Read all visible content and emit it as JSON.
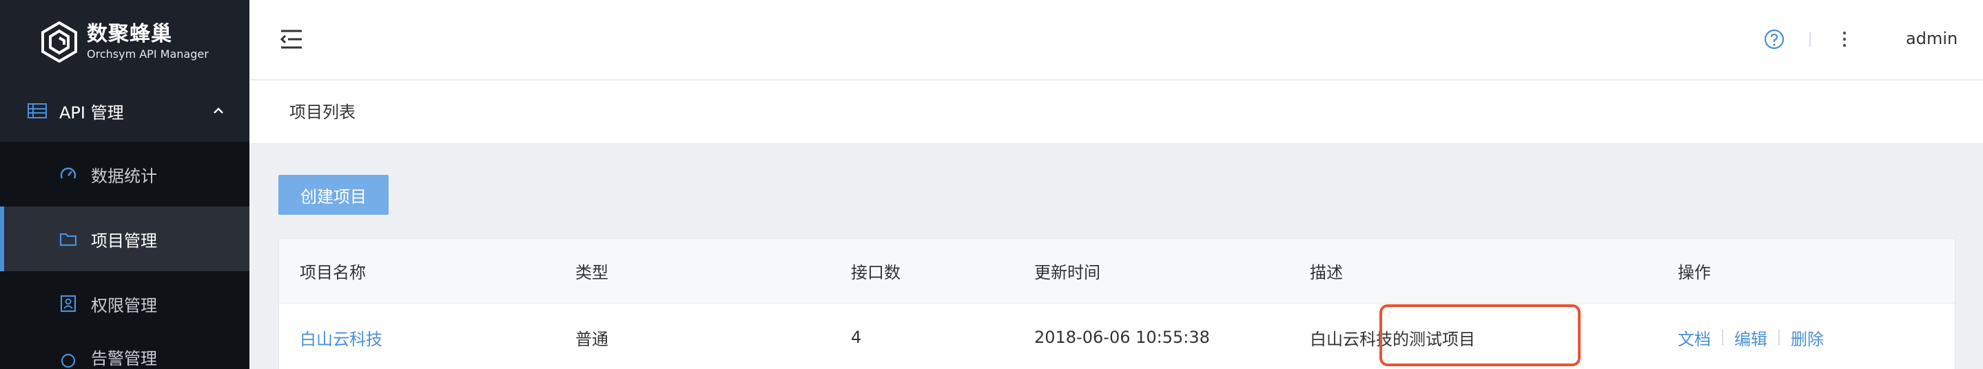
{
  "brand": {
    "name_cn": "数聚蜂巢",
    "name_en": "Orchsym API Manager"
  },
  "sidebar": {
    "group": {
      "label": "API 管理"
    },
    "items": [
      {
        "label": "数据统计",
        "icon": "gauge-icon"
      },
      {
        "label": "项目管理",
        "icon": "folder-icon",
        "active": true
      },
      {
        "label": "权限管理",
        "icon": "id-card-icon"
      },
      {
        "label": "告警管理",
        "icon": "alarm-icon"
      }
    ]
  },
  "header": {
    "user": "admin"
  },
  "breadcrumb": {
    "title": "项目列表"
  },
  "toolbar": {
    "create_label": "创建项目"
  },
  "table": {
    "columns": [
      "项目名称",
      "类型",
      "接口数",
      "更新时间",
      "描述",
      "操作"
    ],
    "rows": [
      {
        "name": "白山云科技",
        "type": "普通",
        "count": "4",
        "updated": "2018-06-06 10:55:38",
        "desc": "白山云科技的测试项目",
        "actions": {
          "docs": "文档",
          "edit": "编辑",
          "delete": "删除"
        }
      }
    ]
  },
  "colors": {
    "accent": "#4a90d9",
    "sidebar": "#1d2129",
    "highlight": "#e8552f"
  }
}
